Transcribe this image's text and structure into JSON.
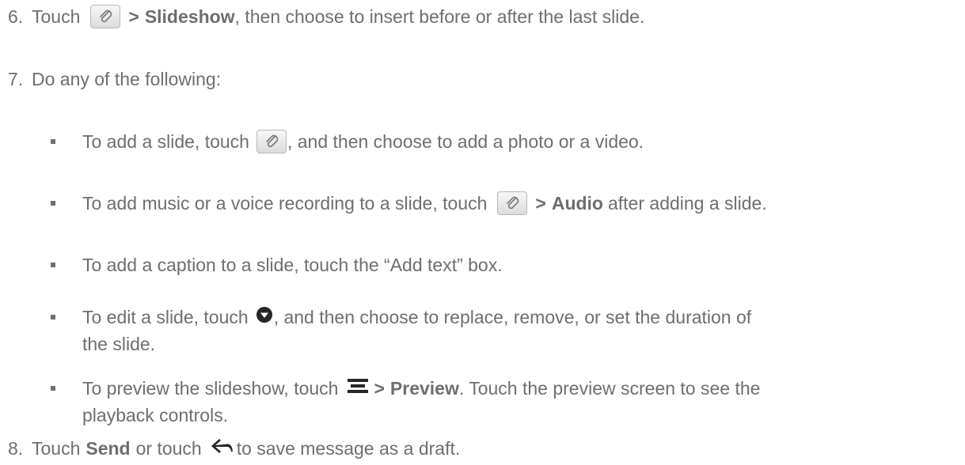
{
  "steps": {
    "s6": {
      "number": "6.",
      "touch": "Touch",
      "sep": ">",
      "bold": "Slideshow",
      "rest": ", then choose to insert before or after the last slide."
    },
    "s7": {
      "number": "7.",
      "text": "Do any of the following:"
    },
    "s8": {
      "number": "8.",
      "touch": "Touch",
      "bold": "Send",
      "mid": "or touch",
      "rest": "to save message as a draft."
    }
  },
  "bullets": {
    "b1": {
      "pre": "To add a slide, touch",
      "post": ", and then choose to add a photo or a video."
    },
    "b2": {
      "pre": "To add music or a voice recording to a slide, touch",
      "sep": ">",
      "bold": "Audio",
      "post": "after adding a slide."
    },
    "b3": {
      "text": "To add a caption to a slide, touch the “Add text” box."
    },
    "b4": {
      "pre": "To edit a slide, touch",
      "post": ", and then choose to replace, remove, or set the duration of",
      "cont": "the slide."
    },
    "b5": {
      "pre": "To preview the slideshow, touch",
      "sep": ">",
      "bold": "Preview",
      "post": ". Touch the preview screen to see the",
      "cont": "playback controls."
    }
  },
  "icons": {
    "attach": "paperclip-icon",
    "edit": "down-arrow-circle-icon",
    "menu": "menu-icon",
    "back": "back-arrow-icon"
  }
}
